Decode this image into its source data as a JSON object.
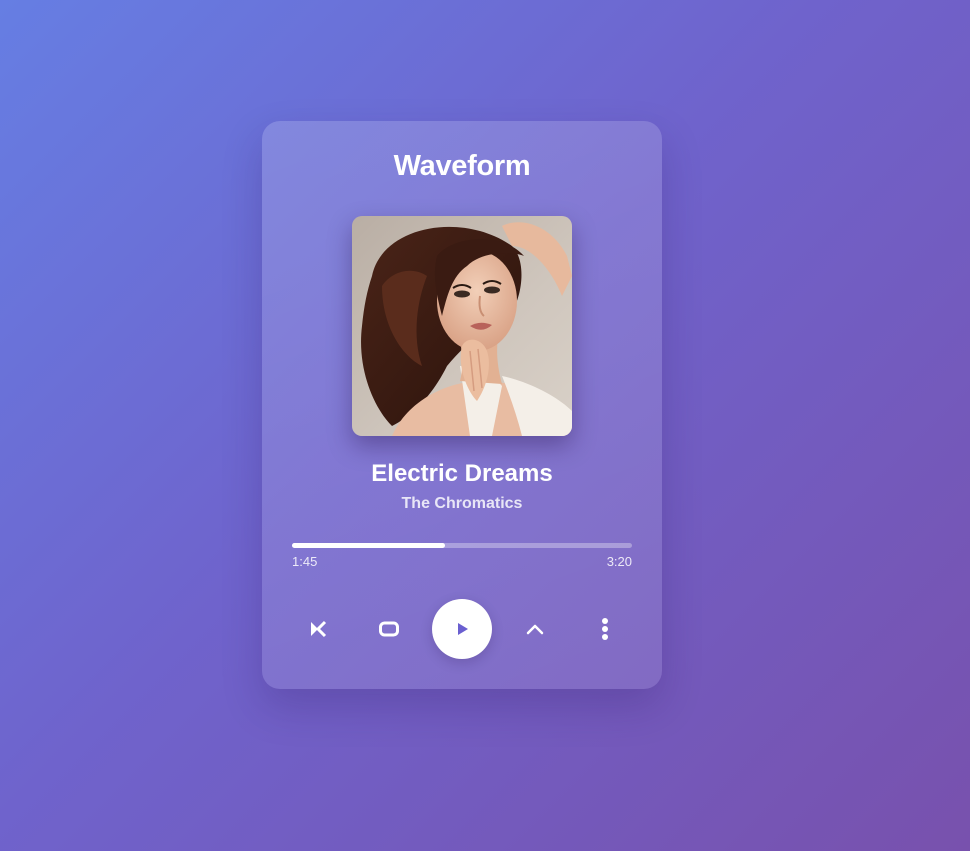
{
  "app": {
    "title": "Waveform"
  },
  "track": {
    "title": "Electric Dreams",
    "artist": "The Chromatics",
    "cover_icon": "album-art-image"
  },
  "progress": {
    "current_time": "1:45",
    "total_time": "3:20",
    "fraction": 0.45
  },
  "controls": [
    {
      "name": "shuffle-button",
      "icon": "shuffle-icon"
    },
    {
      "name": "repeat-button",
      "icon": "repeat-icon"
    },
    {
      "name": "play-button",
      "icon": "play-icon"
    },
    {
      "name": "expand-button",
      "icon": "chevron-up-icon"
    },
    {
      "name": "more-options-button",
      "icon": "more-vertical-icon"
    }
  ],
  "colors": {
    "background_start": "#667ee3",
    "background_end": "#7851ad",
    "accent": "#6a5fd0",
    "text": "#ffffff"
  }
}
